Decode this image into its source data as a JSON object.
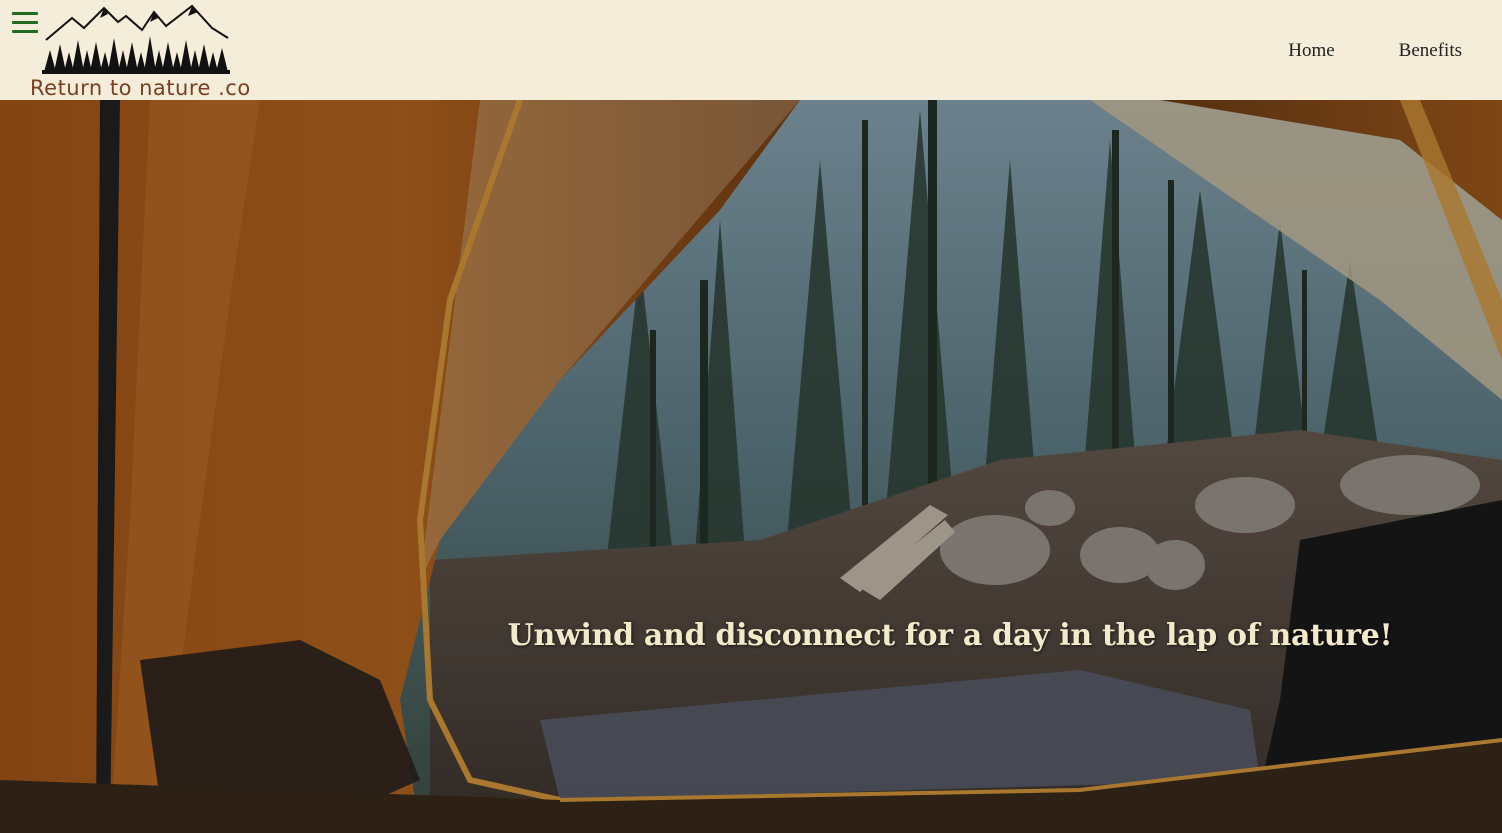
{
  "header": {
    "logo_text": "Return to nature .co",
    "nav": [
      {
        "label": "Home"
      },
      {
        "label": "Benefits"
      }
    ]
  },
  "hero": {
    "tagline": "Unwind and disconnect for a day in the lap of nature!"
  },
  "colors": {
    "header_bg": "#f3edd9",
    "hamburger": "#1f6b1f",
    "logo_text": "#7a3f22",
    "tagline": "#f3eacb"
  },
  "icons": {
    "menu": "hamburger-icon",
    "logo": "mountain-forest-logo"
  }
}
